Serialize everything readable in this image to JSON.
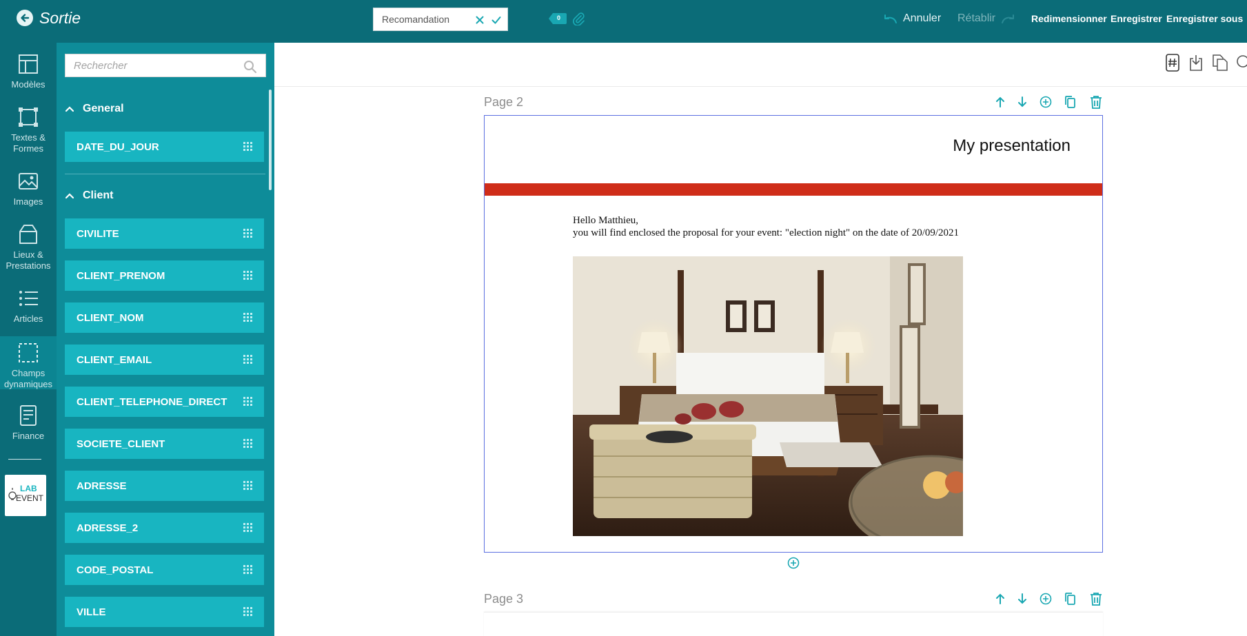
{
  "topbar": {
    "back_label": "Sortie",
    "name_value": "Recomandation",
    "tag_count": "0",
    "undo_label": "Annuler",
    "redo_label": "Rétablir",
    "resize_label": "Redimensionner",
    "save_label": "Enregistrer",
    "save_as_label": "Enregistrer sous"
  },
  "rail": {
    "items": [
      {
        "line1": "Modèles",
        "line2": ""
      },
      {
        "line1": "Textes &",
        "line2": "Formes"
      },
      {
        "line1": "Images",
        "line2": ""
      },
      {
        "line1": "Lieux &",
        "line2": "Prestations"
      },
      {
        "line1": "Articles",
        "line2": ""
      },
      {
        "line1": "Champs",
        "line2": "dynamiques"
      },
      {
        "line1": "Finance",
        "line2": ""
      }
    ],
    "logo": {
      "line1": "LAB",
      "line2": "EVENT"
    }
  },
  "panel": {
    "search_placeholder": "Rechercher",
    "sections": [
      {
        "label": "General",
        "fields": [
          "DATE_DU_JOUR"
        ]
      },
      {
        "label": "Client",
        "fields": [
          "CIVILITE",
          "CLIENT_PRENOM",
          "CLIENT_NOM",
          "CLIENT_EMAIL",
          "CLIENT_TELEPHONE_DIRECT",
          "SOCIETE_CLIENT",
          "ADRESSE",
          "ADRESSE_2",
          "CODE_POSTAL",
          "VILLE"
        ]
      }
    ]
  },
  "canvas": {
    "pages": [
      {
        "label": "Page 2",
        "title": "My presentation",
        "greeting_line1": "Hello Matthieu,",
        "greeting_line2": "you will find enclosed the proposal for your event: \"election night\" on the date of 20/09/2021"
      },
      {
        "label": "Page 3"
      }
    ]
  },
  "colors": {
    "topbar": "#0b6c78",
    "panel": "#0e8c99",
    "field": "#18b5c1",
    "accent": "#19a7b2",
    "redbar": "#cf2d19",
    "page_border": "#5b6fe0"
  }
}
